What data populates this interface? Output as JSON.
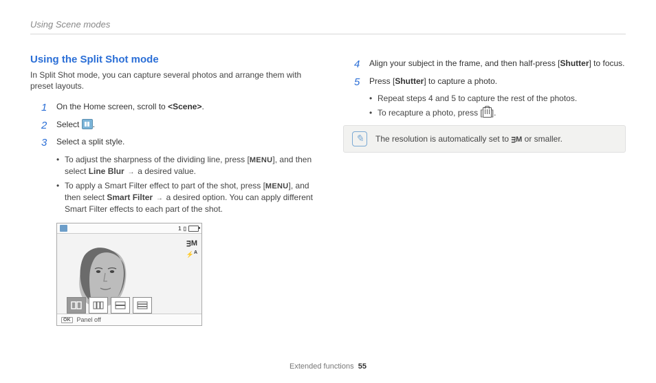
{
  "header": {
    "breadcrumb": "Using Scene modes"
  },
  "title": "Using the Split Shot mode",
  "intro": "In Split Shot mode, you can capture several photos and arrange them with preset layouts.",
  "steps": {
    "s1": {
      "num": "1",
      "pre": "On the Home screen, scroll to ",
      "bold": "<Scene>",
      "post": "."
    },
    "s2": {
      "num": "2",
      "pre": "Select ",
      "post": "."
    },
    "s3": {
      "num": "3",
      "text": "Select a split style.",
      "b1_pre": "To adjust the sharpness of the dividing line, press [",
      "b1_btn": "MENU",
      "b1_mid": "], and then select ",
      "b1_bold": "Line Blur",
      "b1_post": " a desired value.",
      "b2_pre": "To apply a Smart Filter effect to part of the shot, press [",
      "b2_btn": "MENU",
      "b2_mid": "], and then select ",
      "b2_bold": "Smart Filter",
      "b2_post": " a desired option. You can apply different Smart Filter effects to each part of the shot."
    },
    "s4": {
      "num": "4",
      "pre": "Align your subject in the frame, and then half-press [",
      "bold": "Shutter",
      "post": "] to focus."
    },
    "s5": {
      "num": "5",
      "pre": "Press [",
      "bold": "Shutter",
      "post": "] to capture a photo.",
      "b1": "Repeat steps 4 and 5 to capture the rest of the photos.",
      "b2_pre": "To recapture a photo, press [",
      "b2_post": "]."
    }
  },
  "camera": {
    "counter": "1",
    "flash_icon": "⚡",
    "side1": "ᴟM",
    "side2": "A",
    "ok": "OK",
    "panel_off": "Panel off"
  },
  "note": {
    "text_pre": "The resolution is automatically set to ",
    "res": "ᴟM",
    "text_post": " or smaller."
  },
  "footer": {
    "section": "Extended functions",
    "page": "55"
  }
}
